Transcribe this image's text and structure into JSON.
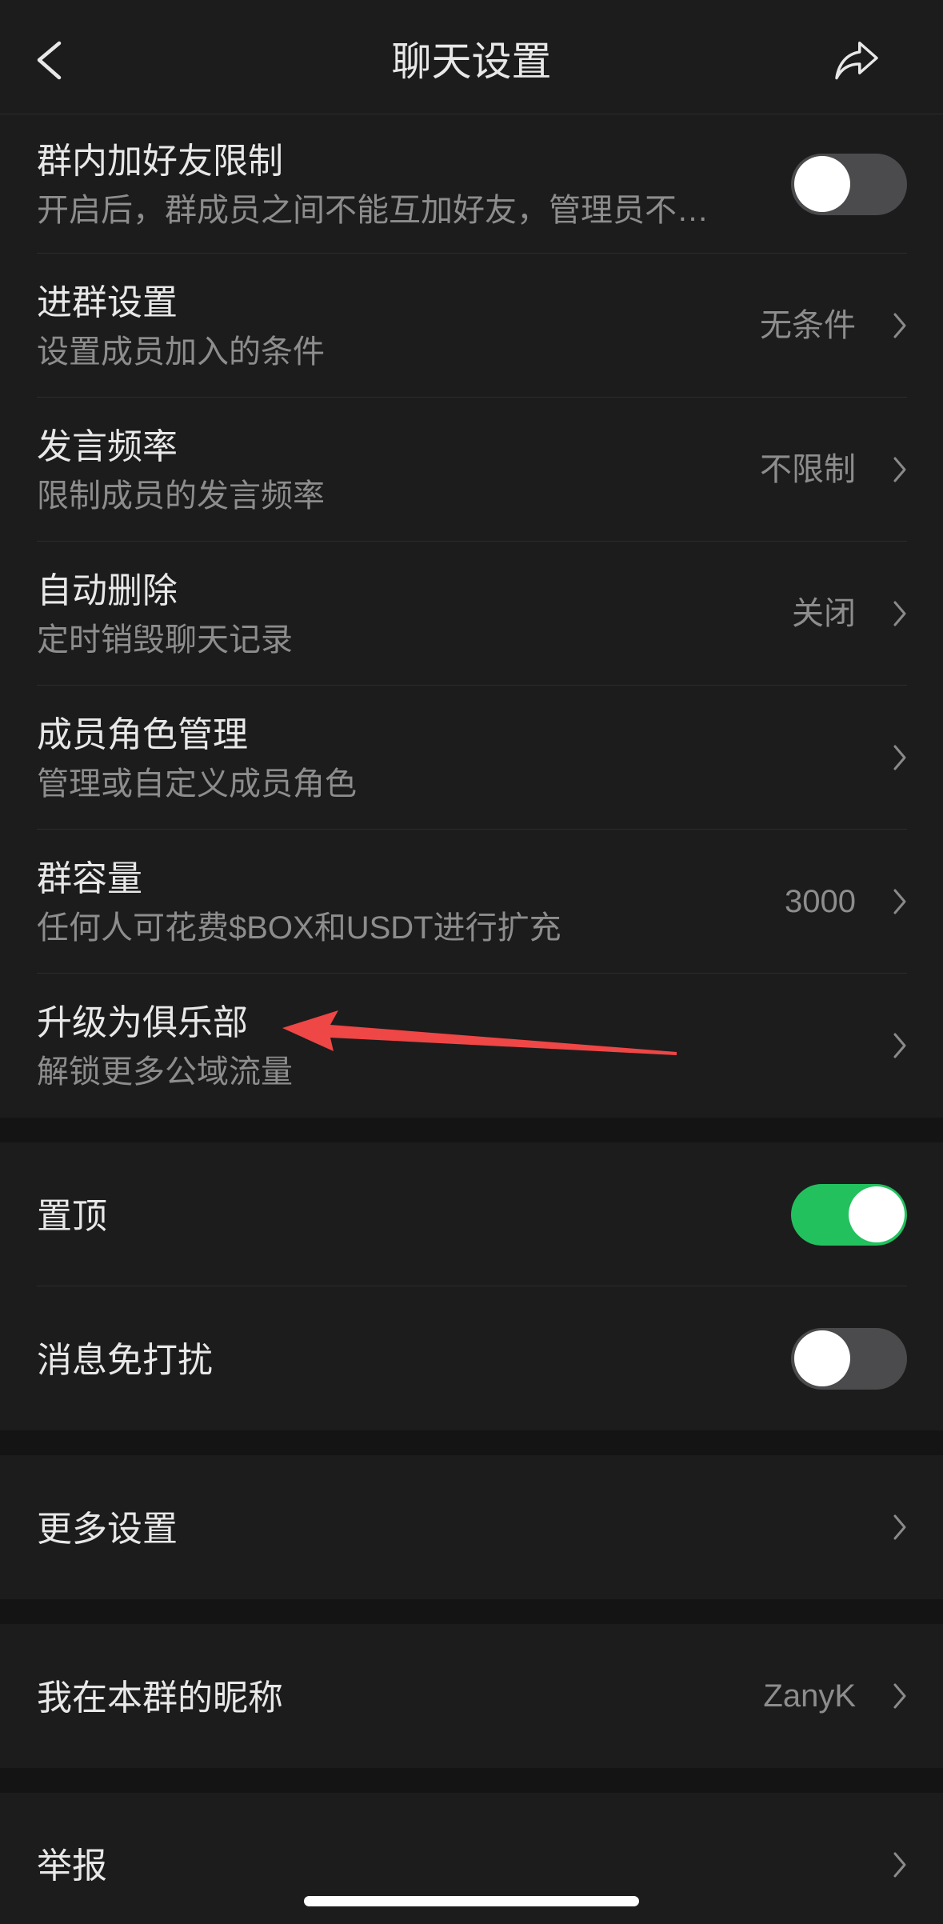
{
  "colors": {
    "background": "#1c1c1c",
    "section_gap": "#141414",
    "text_primary": "#e8e8e8",
    "text_secondary": "#8d8d8d",
    "divider": "#2c2c2c",
    "toggle_on": "#22c15e",
    "toggle_off": "#4b4b4d",
    "annotation_arrow": "#ef4646"
  },
  "header": {
    "title": "聊天设置",
    "back_icon": "chevron-left-icon",
    "share_icon": "share-icon"
  },
  "group_settings": [
    {
      "title": "群内加好友限制",
      "subtitle": "开启后，群成员之间不能互加好友，管理员不…",
      "toggle": false
    },
    {
      "title": "进群设置",
      "subtitle": "设置成员加入的条件",
      "value": "无条件"
    },
    {
      "title": "发言频率",
      "subtitle": "限制成员的发言频率",
      "value": "不限制"
    },
    {
      "title": "自动删除",
      "subtitle": "定时销毁聊天记录",
      "value": "关闭"
    },
    {
      "title": "成员角色管理",
      "subtitle": "管理或自定义成员角色"
    },
    {
      "title": "群容量",
      "subtitle": "任何人可花费$BOX和USDT进行扩充",
      "value": "3000"
    },
    {
      "title": "升级为俱乐部",
      "subtitle": "解锁更多公域流量"
    }
  ],
  "chat_options": [
    {
      "title": "置顶",
      "toggle": true
    },
    {
      "title": "消息免打扰",
      "toggle": false
    }
  ],
  "more_settings": {
    "title": "更多设置"
  },
  "nickname": {
    "title": "我在本群的昵称",
    "value": "ZanyK"
  },
  "report": {
    "title": "举报"
  }
}
